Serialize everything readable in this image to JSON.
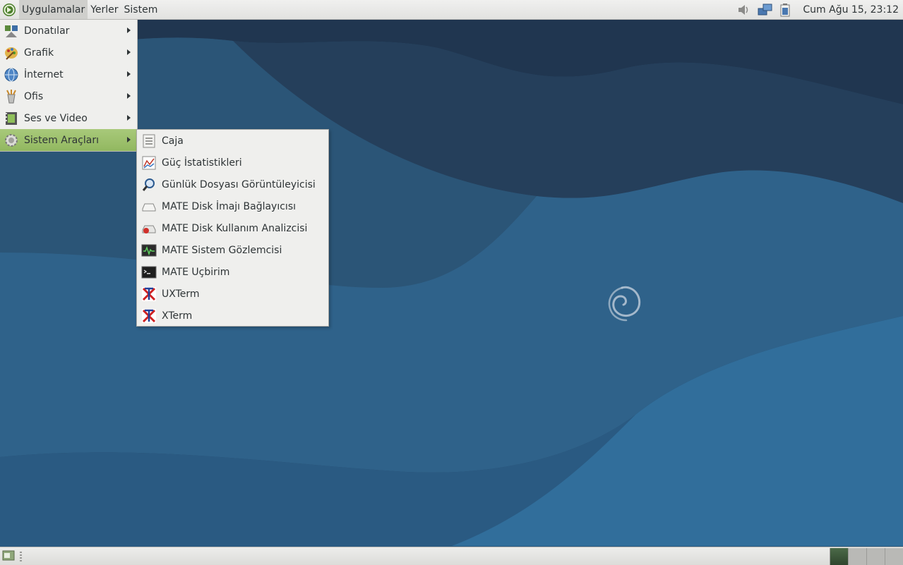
{
  "top_panel": {
    "menus": [
      "Uygulamalar",
      "Yerler",
      "Sistem"
    ],
    "clock": "Cum Ağu 15, 23:12"
  },
  "app_menu": {
    "items": [
      {
        "label": "Donatılar",
        "icon": "accessories-icon"
      },
      {
        "label": "Grafik",
        "icon": "graphics-icon"
      },
      {
        "label": "İnternet",
        "icon": "internet-globe-icon"
      },
      {
        "label": "Ofis",
        "icon": "office-icon"
      },
      {
        "label": "Ses ve Video",
        "icon": "multimedia-icon"
      },
      {
        "label": "Sistem Araçları",
        "icon": "system-tools-gear-icon"
      }
    ],
    "selected": "Sistem Araçları"
  },
  "sub_menu": {
    "items": [
      {
        "label": "Caja",
        "icon": "file-manager-icon"
      },
      {
        "label": "Güç İstatistikleri",
        "icon": "power-statistics-icon"
      },
      {
        "label": "Günlük Dosyası Görüntüleyicisi",
        "icon": "log-viewer-magnifier-icon"
      },
      {
        "label": "MATE Disk İmajı Bağlayıcısı",
        "icon": "disk-image-mounter-icon"
      },
      {
        "label": "MATE Disk Kullanım Analizcisi",
        "icon": "disk-usage-analyzer-icon"
      },
      {
        "label": "MATE Sistem Gözlemcisi",
        "icon": "system-monitor-icon"
      },
      {
        "label": "MATE Uçbirim",
        "icon": "terminal-icon"
      },
      {
        "label": "UXTerm",
        "icon": "xterm-x-icon"
      },
      {
        "label": "XTerm",
        "icon": "xterm-x-icon"
      }
    ]
  },
  "colors": {
    "wallpaper_dark": "#243e57",
    "wallpaper_light": "#2f6a95",
    "menu_highlight": "#9cc06c"
  }
}
